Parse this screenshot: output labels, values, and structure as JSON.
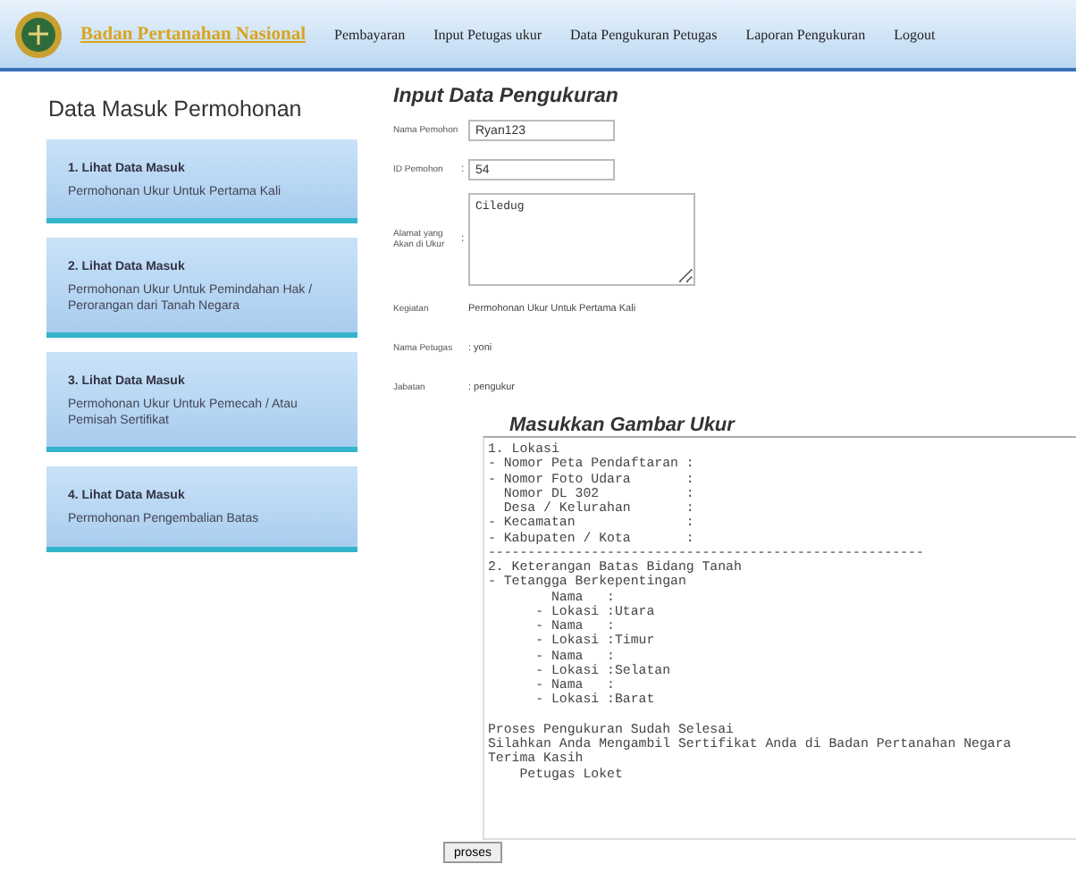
{
  "header": {
    "brand": "Badan Pertanahan Nasional",
    "nav": [
      "Pembayaran",
      "Input Petugas ukur",
      "Data Pengukuran Petugas",
      "Laporan Pengukuran",
      "Logout"
    ]
  },
  "sidebar": {
    "title": "Data Masuk Permohonan",
    "cards": [
      {
        "title": "1. Lihat Data Masuk",
        "description": "Permohonan Ukur Untuk Pertama Kali"
      },
      {
        "title": "2. Lihat Data Masuk",
        "description": "Permohonan Ukur Untuk Pemindahan Hak / Perorangan dari Tanah Negara"
      },
      {
        "title": "3. Lihat Data Masuk",
        "description": "Permohonan Ukur Untuk Pemecah / Atau Pemisah Sertifikat"
      },
      {
        "title": "4. Lihat Data Masuk",
        "description": "Permohonan Pengembalian Batas"
      }
    ]
  },
  "form": {
    "title": "Input Data Pengukuran",
    "rows": [
      {
        "kind": "input",
        "label": "Nama Pemohon",
        "value": "Ryan123"
      },
      {
        "kind": "input",
        "label": "ID Pemohon",
        "colon": ":",
        "value": "54"
      },
      {
        "kind": "textarea",
        "label": "Alamat yang Akan di Ukur",
        "colon": ":",
        "value": "Ciledug"
      },
      {
        "kind": "text",
        "label": "Kegiatan",
        "value": "Permohonan Ukur Untuk Pertama Kali"
      },
      {
        "kind": "text",
        "label": "Nama Petugas",
        "value": ": yoni"
      },
      {
        "kind": "text",
        "label": "Jabatan",
        "value": ": pengukur"
      }
    ],
    "image_section": {
      "title": "Masukkan Gambar Ukur",
      "content": "1. Lokasi\n- Nomor Peta Pendaftaran :\n- Nomor Foto Udara       :\n  Nomor DL 302           :\n  Desa / Kelurahan       :\n- Kecamatan              :\n- Kabupaten / Kota       :\n-------------------------------------------------------\n2. Keterangan Batas Bidang Tanah\n- Tetangga Berkepentingan\n        Nama   :\n      - Lokasi :Utara\n      - Nama   :\n      - Lokasi :Timur\n      - Nama   :\n      - Lokasi :Selatan\n      - Nama   :\n      - Lokasi :Barat\n\nProses Pengukuran Sudah Selesai\nSilahkan Anda Mengambil Sertifikat Anda di Badan Pertanahan Negara\nTerima Kasih\n    Petugas Loket"
    },
    "submit": "proses"
  }
}
